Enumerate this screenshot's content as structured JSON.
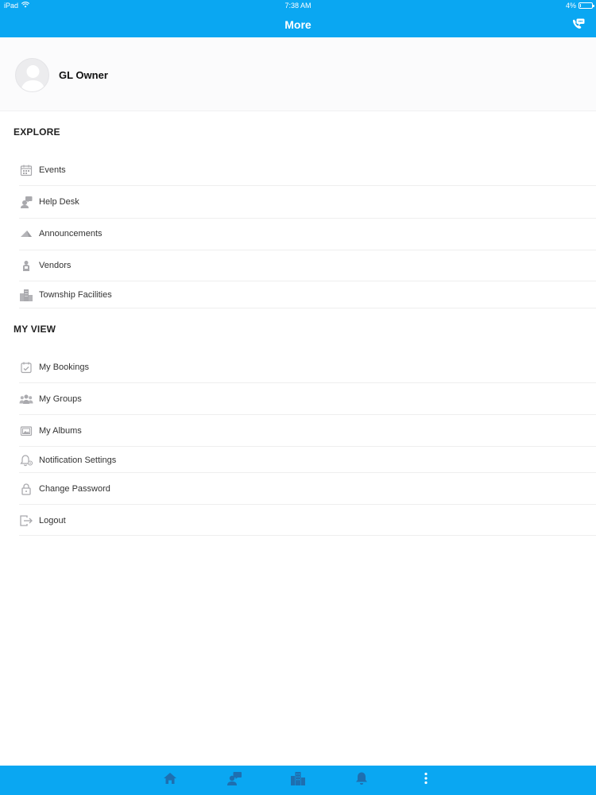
{
  "status_bar": {
    "device": "iPad",
    "time": "7:38 AM",
    "battery_percent_label": "4%",
    "battery_level": 0.04
  },
  "nav": {
    "title": "More",
    "action_icon": "support-chat-icon"
  },
  "profile": {
    "name": "GL Owner",
    "avatar_icon": "default-avatar-icon"
  },
  "explore": {
    "title": "EXPLORE",
    "items": [
      {
        "label": "Events",
        "icon": "calendar-icon"
      },
      {
        "label": "Help Desk",
        "icon": "help-desk-icon"
      },
      {
        "label": "Announcements",
        "icon": "announcement-icon"
      },
      {
        "label": "Vendors",
        "icon": "vendor-icon"
      },
      {
        "label": "Township Facilities",
        "icon": "buildings-icon"
      }
    ]
  },
  "my_view": {
    "title": "MY VIEW",
    "items": [
      {
        "label": "My Bookings",
        "icon": "booking-icon"
      },
      {
        "label": "My Groups",
        "icon": "groups-icon"
      },
      {
        "label": "My Albums",
        "icon": "album-icon"
      },
      {
        "label": "Notification Settings",
        "icon": "notification-settings-icon"
      },
      {
        "label": "Change Password",
        "icon": "lock-icon"
      },
      {
        "label": "Logout",
        "icon": "logout-icon"
      }
    ]
  },
  "tab_bar": {
    "tabs": [
      {
        "name": "home",
        "icon": "home-icon"
      },
      {
        "name": "help-desk",
        "icon": "help-desk-icon"
      },
      {
        "name": "facilities",
        "icon": "buildings-icon"
      },
      {
        "name": "notifications",
        "icon": "bell-icon"
      },
      {
        "name": "more",
        "icon": "more-vertical-icon"
      }
    ]
  },
  "colors": {
    "brand": "#0aa7f2",
    "icon_gray": "#a9a9ad",
    "tab_icon": "#1e6fb0"
  }
}
